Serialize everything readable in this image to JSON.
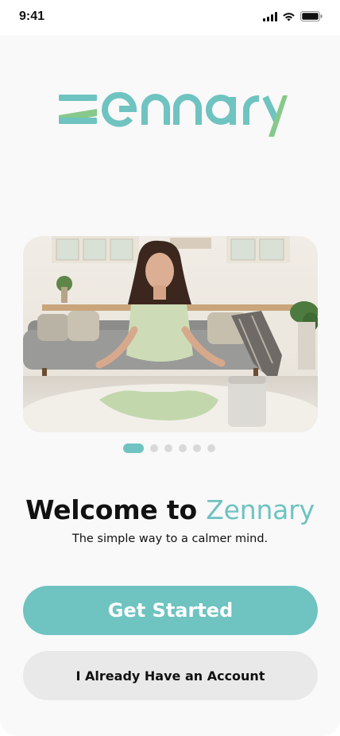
{
  "status_bar": {
    "time": "9:41",
    "icons": [
      "cellular-signal-icon",
      "wifi-icon",
      "battery-icon"
    ]
  },
  "logo": {
    "text": "zennary"
  },
  "hero": {
    "alt": "Woman meditating cross-legged on a rug in a living room"
  },
  "pager": {
    "total": 6,
    "current": 1
  },
  "welcome": {
    "prefix": "Welcome to ",
    "brand": "Zennary",
    "subtitle": "The simple way to a calmer mind."
  },
  "actions": {
    "primary_label": "Get Started",
    "secondary_label": "I Already Have an Account"
  },
  "colors": {
    "accent": "#6fc3c1",
    "accent_green": "#86c98a",
    "secondary_bg": "#e9e9e9"
  }
}
